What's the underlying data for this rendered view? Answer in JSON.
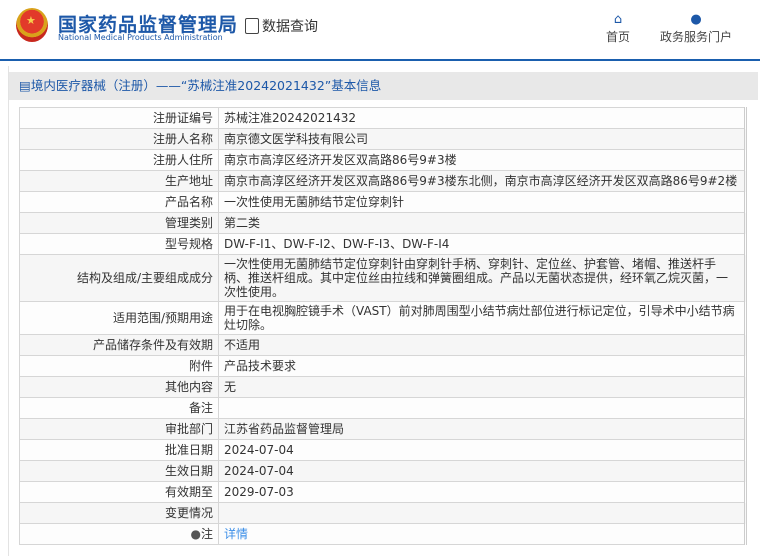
{
  "header": {
    "org_cn": "国家药品监督管理局",
    "org_en": "National Medical Products Administration",
    "data_query": "数据查询",
    "nav": [
      {
        "label": "首页",
        "icon": "home-icon"
      },
      {
        "label": "政务服务门户",
        "icon": "user-icon"
      }
    ]
  },
  "title": "境内医疗器械（注册）——“苏械注准20242021432”基本信息",
  "rows": [
    {
      "label": "注册证编号",
      "value": "苏械注准20242021432"
    },
    {
      "label": "注册人名称",
      "value": "南京德文医学科技有限公司"
    },
    {
      "label": "注册人住所",
      "value": "南京市高淳区经济开发区双高路86号9#3楼"
    },
    {
      "label": "生产地址",
      "value": "南京市高淳区经济开发区双高路86号9#3楼东北侧，南京市高淳区经济开发区双高路86号9#2楼"
    },
    {
      "label": "产品名称",
      "value": "一次性使用无菌肺结节定位穿刺针"
    },
    {
      "label": "管理类别",
      "value": "第二类"
    },
    {
      "label": "型号规格",
      "value": "DW-F-I1、DW-F-I2、DW-F-I3、DW-F-I4"
    },
    {
      "label": "结构及组成/主要组成成分",
      "value": "一次性使用无菌肺结节定位穿刺针由穿刺针手柄、穿刺针、定位丝、护套管、堵帽、推送杆手柄、推送杆组成。其中定位丝由拉线和弹簧圈组成。产品以无菌状态提供，经环氧乙烷灭菌，一次性使用。"
    },
    {
      "label": "适用范围/预期用途",
      "value": "用于在电视胸腔镜手术（VAST）前对肺周围型小结节病灶部位进行标记定位，引导术中小结节病灶切除。"
    },
    {
      "label": "产品储存条件及有效期",
      "value": "不适用"
    },
    {
      "label": "附件",
      "value": "产品技术要求"
    },
    {
      "label": "其他内容",
      "value": "无"
    },
    {
      "label": "备注",
      "value": ""
    },
    {
      "label": "审批部门",
      "value": "江苏省药品监督管理局"
    },
    {
      "label": "批准日期",
      "value": "2024-07-04"
    },
    {
      "label": "生效日期",
      "value": "2024-07-04"
    },
    {
      "label": "有效期至",
      "value": "2029-07-03"
    },
    {
      "label": "变更情况",
      "value": ""
    }
  ],
  "note": {
    "label": "注",
    "link": "详情"
  }
}
